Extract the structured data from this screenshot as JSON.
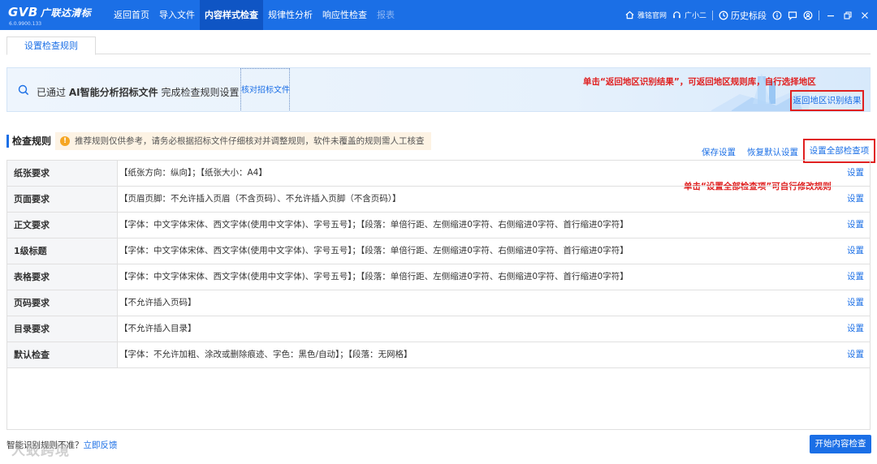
{
  "app": {
    "logo_text": "GVB",
    "logo_cn": "广联达清标",
    "version": "6.0.9900.133"
  },
  "nav": [
    {
      "label": "返回首页",
      "state": "normal"
    },
    {
      "label": "导入文件",
      "state": "normal"
    },
    {
      "label": "内容样式检查",
      "state": "active"
    },
    {
      "label": "规律性分析",
      "state": "normal"
    },
    {
      "label": "响应性检查",
      "state": "normal"
    },
    {
      "label": "报表",
      "state": "disabled"
    }
  ],
  "top_right": {
    "website_label": "雅铭官网",
    "assistant_label": "广小二",
    "history_label": "历史标段"
  },
  "tab": {
    "label": "设置检查规则"
  },
  "banner": {
    "prefix": "已通过",
    "highlight": "AI智能分析招标文件",
    "suffix": "完成检查规则设置",
    "verify_link": "核对招标文件",
    "return_button": "返回地区识别结果",
    "annotation": "单击“返回地区识别结果”，可返回地区规则库，自行选择地区"
  },
  "rules": {
    "title": "检查规则",
    "tip": "推荐规则仅供参考，请务必根据招标文件仔细核对并调整规则，软件未覆盖的规则需人工核查",
    "save_label": "保存设置",
    "restore_label": "恢复默认设置",
    "set_all_label": "设置全部检查项",
    "annotation": "单击“设置全部检查项”可自行修改规则",
    "set_label": "设置",
    "items": [
      {
        "name": "纸张要求",
        "value": "【纸张方向：纵向】；【纸张大小：A4】"
      },
      {
        "name": "页面要求",
        "value": "【页眉页脚：不允许插入页眉（不含页码）、不允许插入页脚（不含页码）】"
      },
      {
        "name": "正文要求",
        "value": "【字体：中文字体宋体、西文字体(使用中文字体)、字号五号】；【段落：单倍行距、左侧缩进0字符、右侧缩进0字符、首行缩进0字符】"
      },
      {
        "name": "1级标题",
        "value": "【字体：中文字体宋体、西文字体(使用中文字体)、字号五号】；【段落：单倍行距、左侧缩进0字符、右侧缩进0字符、首行缩进0字符】"
      },
      {
        "name": "表格要求",
        "value": "【字体：中文字体宋体、西文字体(使用中文字体)、字号五号】；【段落：单倍行距、左侧缩进0字符、右侧缩进0字符、首行缩进0字符】"
      },
      {
        "name": "页码要求",
        "value": "【不允许插入页码】"
      },
      {
        "name": "目录要求",
        "value": "【不允许插入目录】"
      },
      {
        "name": "默认检查",
        "value": "【字体：不允许加粗、涂改或删除痕迹、字色：黑色/自动】；【段落：无网格】"
      }
    ]
  },
  "footer": {
    "question": "智能识别规则不准？",
    "link": "立即反馈",
    "watermark": "人蚁跨境",
    "start_button": "开始内容检查"
  },
  "colors": {
    "primary": "#1b6fe6",
    "annotation_red": "#e02020",
    "tip_bg": "#fdf3e4"
  }
}
